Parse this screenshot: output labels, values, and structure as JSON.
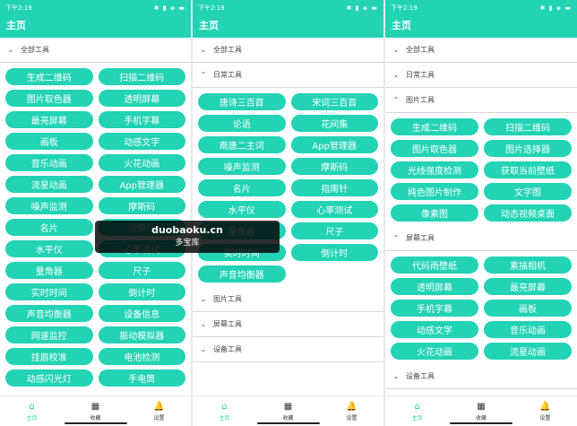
{
  "status": {
    "p1": "下午2:19",
    "p2": "下午2:19",
    "p3": "下午2:19",
    "icons": "✱ ▮ ◈ ▬"
  },
  "app_title": "主页",
  "p1": {
    "sec1": {
      "chev": "⌄",
      "title": "全部工具"
    },
    "chips": [
      "生成二维码",
      "扫描二维码",
      "图片取色器",
      "透明屏幕",
      "最亮屏幕",
      "手机字幕",
      "画板",
      "动感文字",
      "音乐动画",
      "火花动画",
      "流星动画",
      "App管理器",
      "噪声监测",
      "摩斯码",
      "名片",
      "指南针",
      "水平仪",
      "心率测试",
      "量角器",
      "尺子",
      "实时时间",
      "倒计时",
      "声音均衡器",
      "设备信息",
      "网速监控",
      "振动模拟器",
      "挂唇校准",
      "电池检测",
      "动感闪光灯",
      "手电筒"
    ]
  },
  "p2": {
    "sec1": {
      "chev": "⌄",
      "title": "全部工具"
    },
    "sec2": {
      "chev": "⌃",
      "title": "日常工具"
    },
    "chips": [
      "唐诗三百首",
      "宋词三百首",
      "论语",
      "花间集",
      "南唐二主词",
      "App管理器",
      "噪声监测",
      "摩斯码",
      "名片",
      "指南针",
      "水平仪",
      "心率测试",
      "量角器",
      "尺子",
      "实时时间",
      "倒计时",
      "声音均衡器"
    ],
    "sec3": {
      "chev": "⌄",
      "title": "图片工具"
    },
    "sec4": {
      "chev": "⌄",
      "title": "屏幕工具"
    },
    "sec5": {
      "chev": "⌄",
      "title": "设备工具"
    }
  },
  "p3": {
    "sec1": {
      "chev": "⌄",
      "title": "全部工具"
    },
    "sec2": {
      "chev": "⌄",
      "title": "日常工具"
    },
    "sec3": {
      "chev": "⌃",
      "title": "图片工具"
    },
    "img_chips": [
      "生成二维码",
      "扫描二维码",
      "图片取色器",
      "图片选择器",
      "光线强度检测",
      "获取当前壁纸",
      "纯色图片制作",
      "文字图",
      "像素图",
      "动态视频桌面"
    ],
    "sec4": {
      "chev": "⌃",
      "title": "屏幕工具"
    },
    "scr_chips": [
      "代码雨壁纸",
      "素描相机",
      "透明屏幕",
      "最亮屏幕",
      "手机字幕",
      "画板",
      "动感文字",
      "音乐动画",
      "火花动画",
      "流星动画"
    ],
    "sec5": {
      "chev": "⌄",
      "title": "设备工具"
    }
  },
  "nav": [
    {
      "icon": "⌂",
      "label": "主页"
    },
    {
      "icon": "▦",
      "label": "收藏"
    },
    {
      "icon": "🔔",
      "label": "设置"
    }
  ],
  "watermark": {
    "line1": "duobaoku.cn",
    "line2": "多宝库"
  },
  "colors": {
    "accent": "#22d3b4"
  }
}
